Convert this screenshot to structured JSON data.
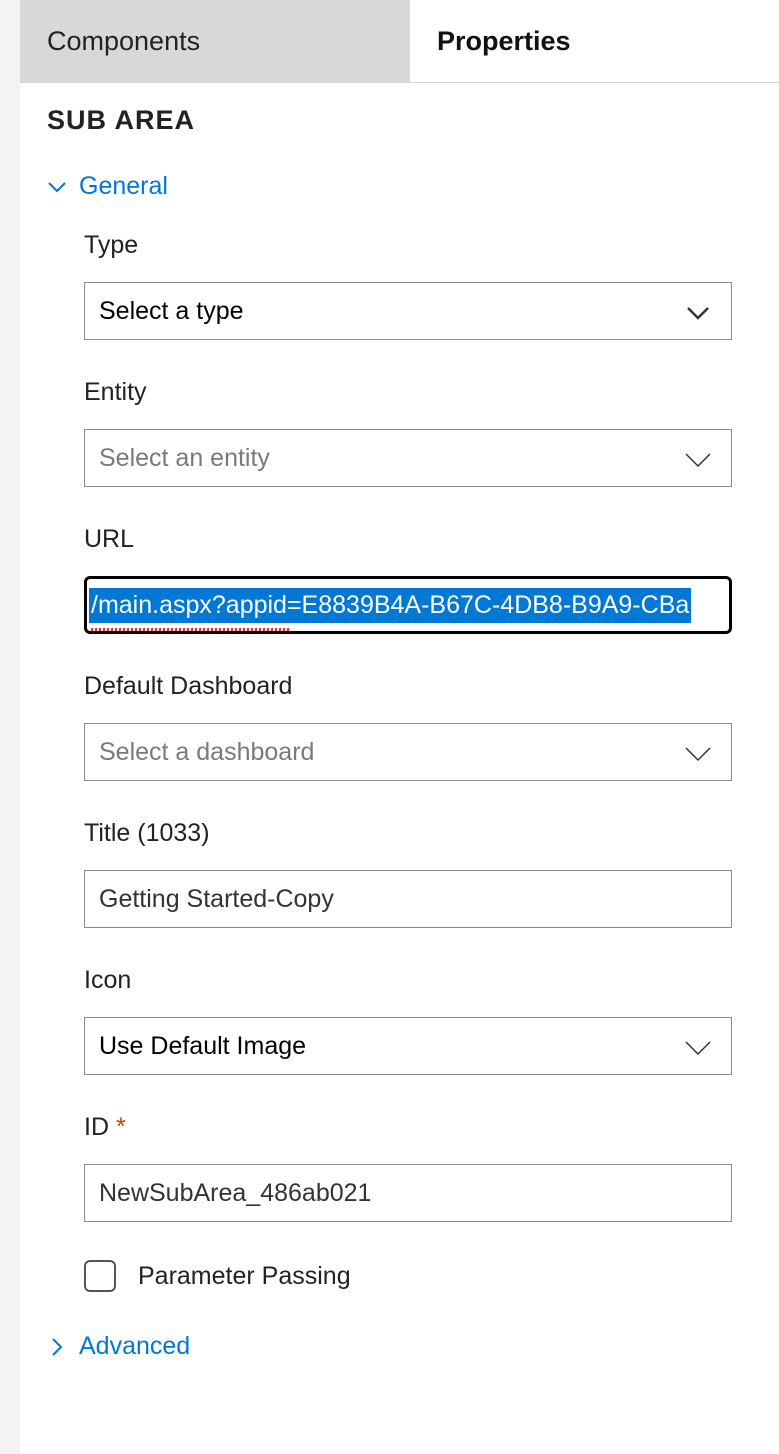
{
  "tabs": {
    "components": "Components",
    "properties": "Properties"
  },
  "header": {
    "title": "SUB AREA"
  },
  "sections": {
    "general_label": "General",
    "advanced_label": "Advanced"
  },
  "fields": {
    "type": {
      "label": "Type",
      "value": "Select a type"
    },
    "entity": {
      "label": "Entity",
      "placeholder": "Select an entity"
    },
    "url": {
      "label": "URL",
      "value": "/main.aspx?appid=E8839B4A-B67C-4DB8-B9A9-CBa"
    },
    "default_dashboard": {
      "label": "Default Dashboard",
      "placeholder": "Select a dashboard"
    },
    "title": {
      "label": "Title (1033)",
      "value": "Getting Started-Copy"
    },
    "icon": {
      "label": "Icon",
      "value": "Use Default Image"
    },
    "id": {
      "label": "ID",
      "required_mark": "*",
      "value": "NewSubArea_486ab021"
    },
    "parameter_passing": {
      "label": "Parameter Passing",
      "checked": false
    }
  }
}
